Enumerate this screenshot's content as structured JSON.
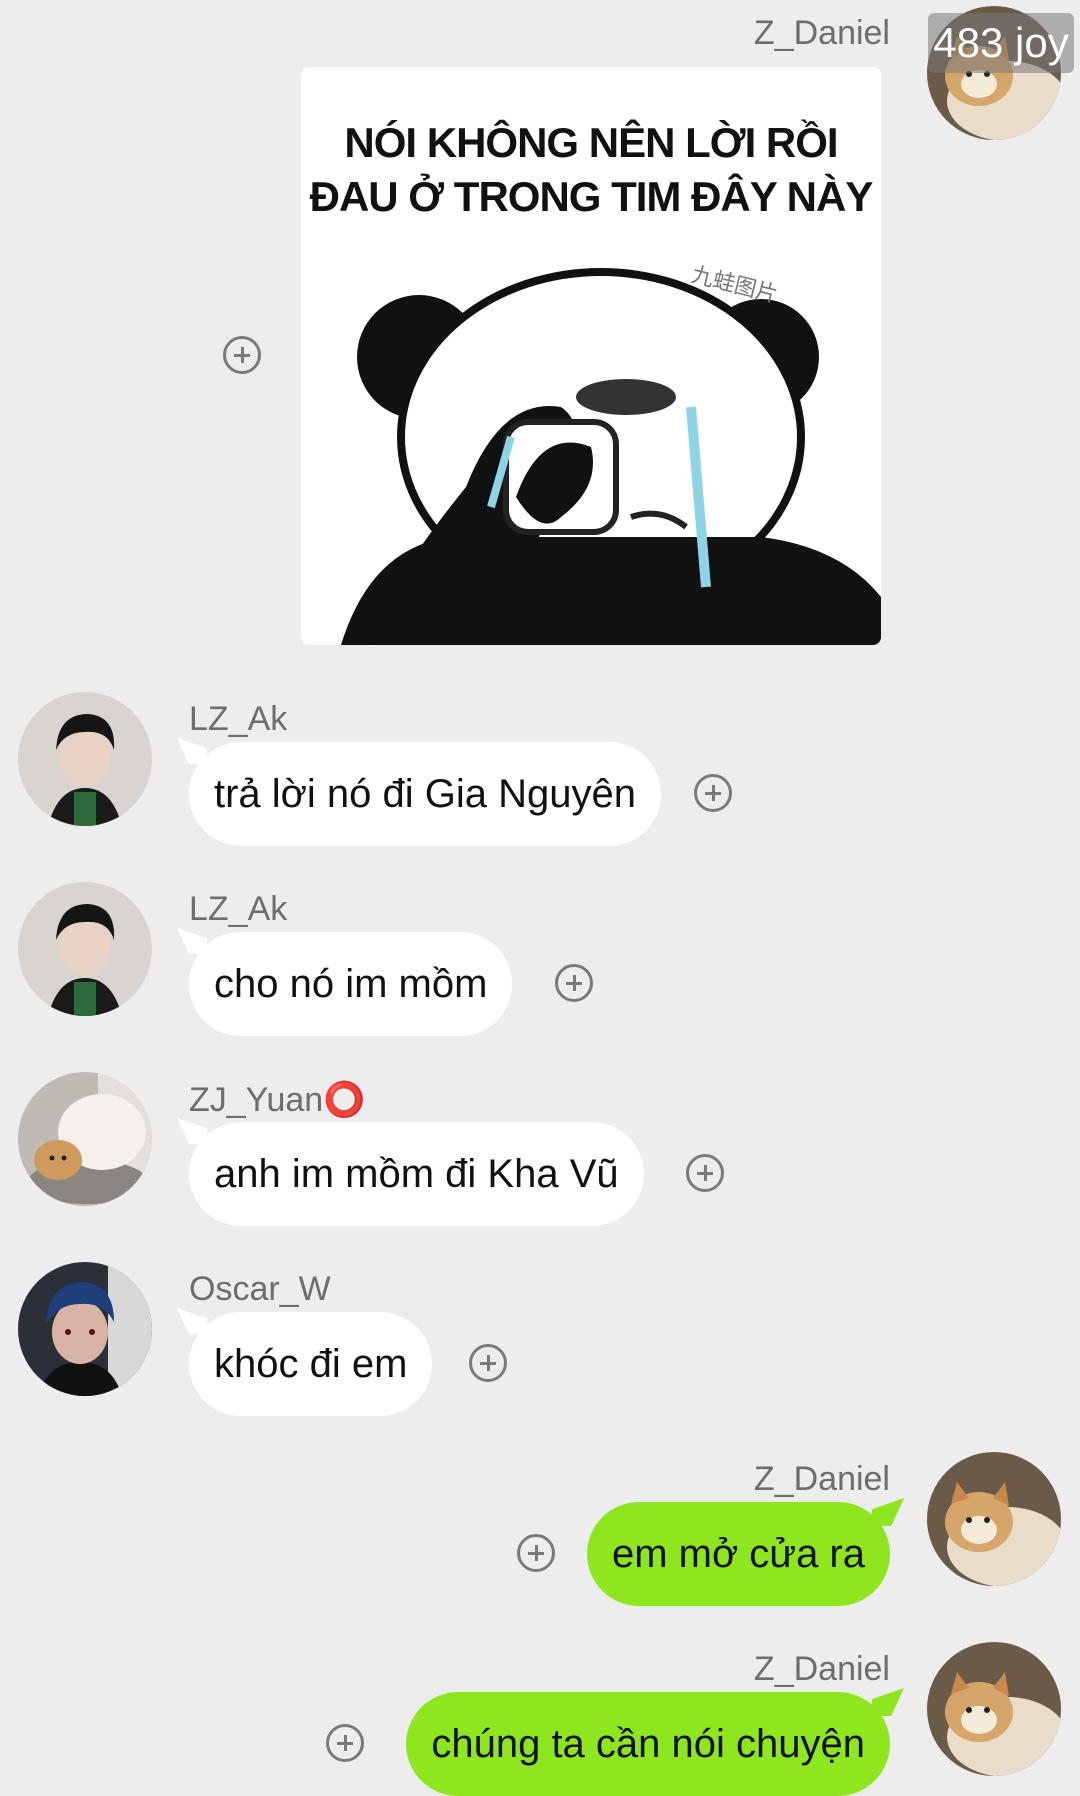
{
  "header": {
    "joy_badge": "483 joy"
  },
  "sticker": {
    "line1": "NÓI KHÔNG NÊN LỜI RỒI",
    "line2": "ĐAU Ở TRONG TIM ĐÂY NÀY",
    "watermark": "九蛙图片"
  },
  "messages": [
    {
      "sender": "Z_Daniel",
      "direction": "out",
      "type": "image"
    },
    {
      "sender": "LZ_Ak",
      "direction": "in",
      "text": "trả lời nó đi Gia Nguyên"
    },
    {
      "sender": "LZ_Ak",
      "direction": "in",
      "text": "cho nó im mồm"
    },
    {
      "sender": "ZJ_Yuan⭕",
      "direction": "in",
      "text": "anh im mồm đi Kha Vũ"
    },
    {
      "sender": "Oscar_W",
      "direction": "in",
      "text": "khóc đi em"
    },
    {
      "sender": "Z_Daniel",
      "direction": "out",
      "text": "em mở cửa ra"
    },
    {
      "sender": "Z_Daniel",
      "direction": "out",
      "text": "chúng ta cần nói chuyện"
    }
  ],
  "colors": {
    "background": "#ededed",
    "incoming_bubble": "#ffffff",
    "outgoing_bubble": "#8ee61f"
  },
  "icons": {
    "add_reaction": "plus-circle-icon"
  }
}
